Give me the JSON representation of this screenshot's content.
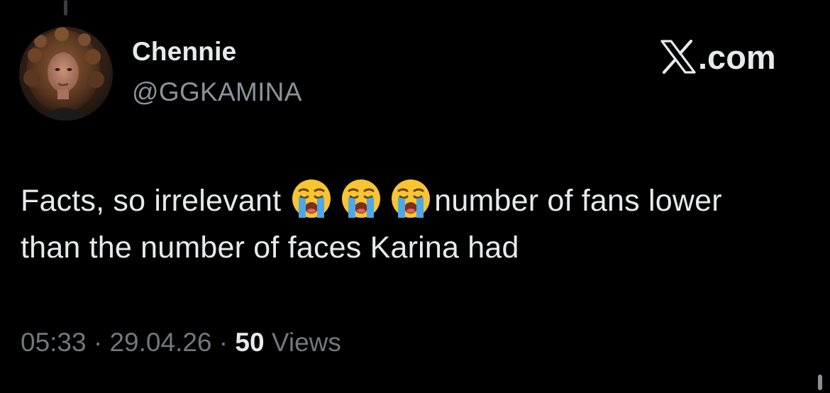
{
  "author": {
    "display_name": "Chennie",
    "handle": "@GGKAMINA",
    "avatar_icon": "profile-photo"
  },
  "brand": {
    "logo_icon": "x-logo-icon",
    "label": ".com"
  },
  "tweet": {
    "text_before_emoji": "Facts, so irrelevant",
    "emojis": [
      "loudly-crying-face",
      "loudly-crying-face",
      "loudly-crying-face"
    ],
    "text_after_emoji": "number of fans lower than the number of faces Karina had"
  },
  "meta": {
    "time": "05:33",
    "separator": "·",
    "date": "29.04.26",
    "views_count": "50",
    "views_label": "Views"
  },
  "colors": {
    "background": "#000000",
    "primary_text": "#e7e9ea",
    "secondary_text": "#8b9299",
    "meta_text": "#72777d",
    "thread_line": "#3a3d41"
  }
}
